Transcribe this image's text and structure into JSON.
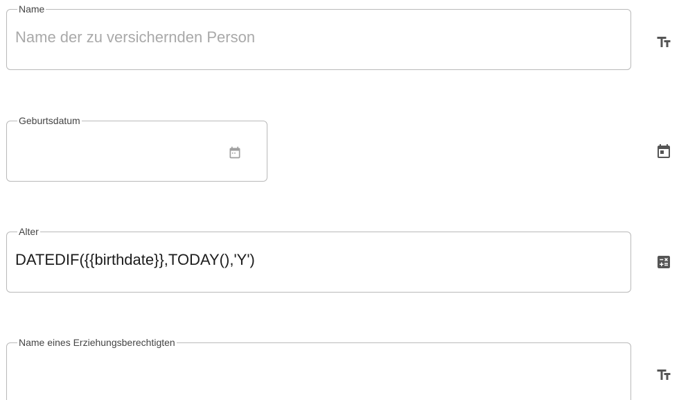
{
  "fields": [
    {
      "label": "Name",
      "value": "",
      "placeholder": "Name der zu versichernden Person",
      "icon": "text-format-icon"
    },
    {
      "label": "Geburtsdatum",
      "value": "",
      "placeholder": "",
      "icon": "calendar-icon"
    },
    {
      "label": "Alter",
      "value": "DATEDIF({{birthdate}},TODAY(),'Y')",
      "placeholder": "",
      "icon": "calculator-icon"
    },
    {
      "label": "Name eines Erziehungsberechtigten",
      "value": "",
      "placeholder": "",
      "icon": "text-format-icon"
    }
  ],
  "colors": {
    "border": "#b9b9b9",
    "icon": "#555555",
    "placeholder": "#a9a9a9",
    "text": "#1c1c1c"
  }
}
